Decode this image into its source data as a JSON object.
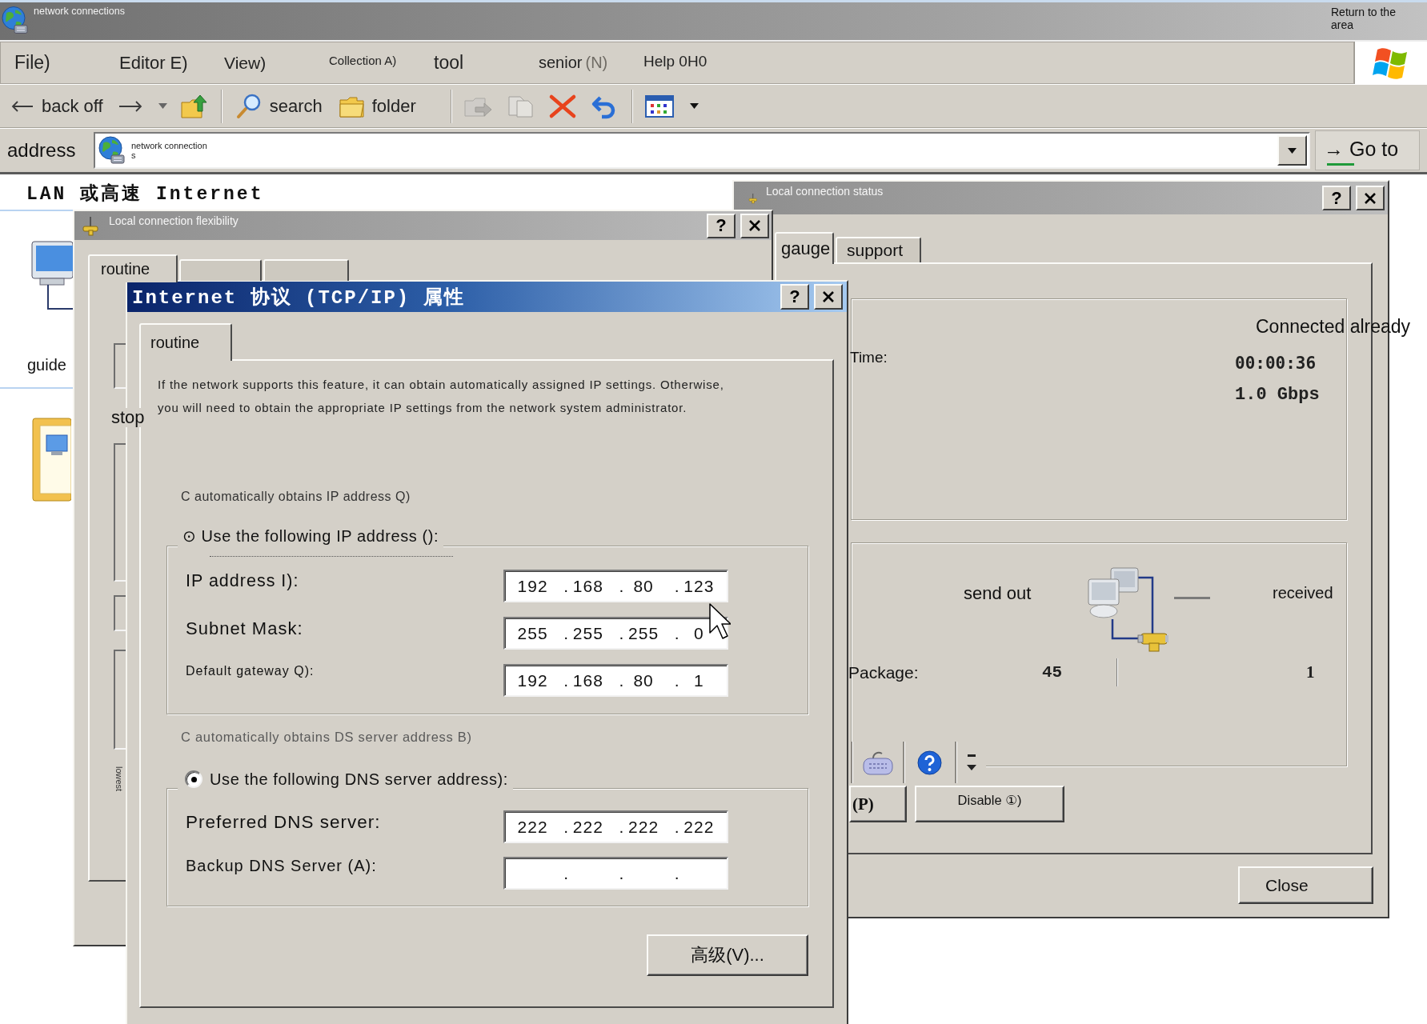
{
  "window": {
    "title": "network connections",
    "corner_text": "Return to the area"
  },
  "menu": [
    {
      "label": "File)"
    },
    {
      "label": "Editor E)"
    },
    {
      "label": "View)"
    },
    {
      "label": "Collection A)"
    },
    {
      "label": "tool"
    },
    {
      "label": "senior",
      "mnemonic": "(N)"
    },
    {
      "label": "Help 0H0"
    }
  ],
  "toolbar": {
    "groups": [
      [
        {
          "kind": "back",
          "label": "back off",
          "disabled": false
        },
        {
          "kind": "forward",
          "disabled": false
        },
        {
          "kind": "up",
          "disabled": false
        }
      ],
      [
        {
          "kind": "search",
          "label": "search",
          "disabled": false
        },
        {
          "kind": "folders",
          "label": "folder",
          "disabled": false
        }
      ],
      [
        {
          "kind": "move",
          "disabled": true
        },
        {
          "kind": "copy",
          "disabled": true
        },
        {
          "kind": "delete",
          "disabled": false
        },
        {
          "kind": "undo",
          "disabled": false
        }
      ],
      [
        {
          "kind": "views",
          "disabled": false
        }
      ]
    ]
  },
  "address_bar": {
    "label": "address",
    "value": "network connections",
    "go_button": "→ Go to"
  },
  "content": {
    "heading": "LAN 或高速 Internet",
    "items": [
      {
        "kind": "network",
        "label": "guide"
      },
      {
        "kind": "wizard"
      }
    ]
  },
  "status_dialog": {
    "title": "Local connection status",
    "active": false,
    "help_button": "?",
    "tabs": [
      {
        "label": "gauge",
        "selected": true
      },
      {
        "label": "support",
        "selected": false
      }
    ],
    "connection": {
      "status": "Connected already",
      "time_label": "Time:",
      "duration": "00:00:36",
      "speed": "1.0 Gbps"
    },
    "activity": {
      "sent_label": "send out",
      "received_label": "received",
      "packets_label": "Package:",
      "packets_sent": "45",
      "packets_received": "1"
    },
    "buttons": [
      "(P)",
      "Disable ①)"
    ],
    "close_button": "Close"
  },
  "properties_dialog": {
    "title": "Local connection flexibility",
    "active": false,
    "help_button": "?",
    "tabs": [
      {
        "label": "routine",
        "selected": true
      },
      {
        "selected": false
      },
      {
        "selected": false
      }
    ],
    "side_label": "stop",
    "vertical_label": "lowest"
  },
  "tcpip_dialog": {
    "title": "Internet 协议 (TCP/IP) 属性",
    "active": true,
    "help_button": "?",
    "tabs": [
      {
        "label": "routine",
        "selected": true
      }
    ],
    "description": "If the network supports this feature, it can obtain automatically assigned IP settings. Otherwise, you will need to obtain the appropriate IP settings from the network system administrator.",
    "auto_ip_option": "C automatically obtains IP address Q)",
    "manual_ip_option": "⊙ Use the following IP address ():",
    "separator": ".",
    "ip_fields": [
      {
        "label": "IP address I):",
        "octets": [
          "192",
          "168",
          "80",
          "123"
        ]
      },
      {
        "label": "Subnet Mask:",
        "octets": [
          "255",
          "255",
          "255",
          "0"
        ]
      },
      {
        "label": "Default gateway Q):",
        "octets": [
          "192",
          "168",
          "80",
          "1"
        ]
      }
    ],
    "auto_dns_option": "C automatically obtains DS server address B)",
    "manual_dns_option": {
      "label": "Use the following DNS server address):",
      "selected": true
    },
    "dns_fields": [
      {
        "label": "Preferred DNS server:",
        "octets": [
          "222",
          "222",
          "222",
          "222"
        ]
      },
      {
        "label": "Backup DNS Server (A):"
      }
    ],
    "advanced_button": "高级(V)..."
  }
}
